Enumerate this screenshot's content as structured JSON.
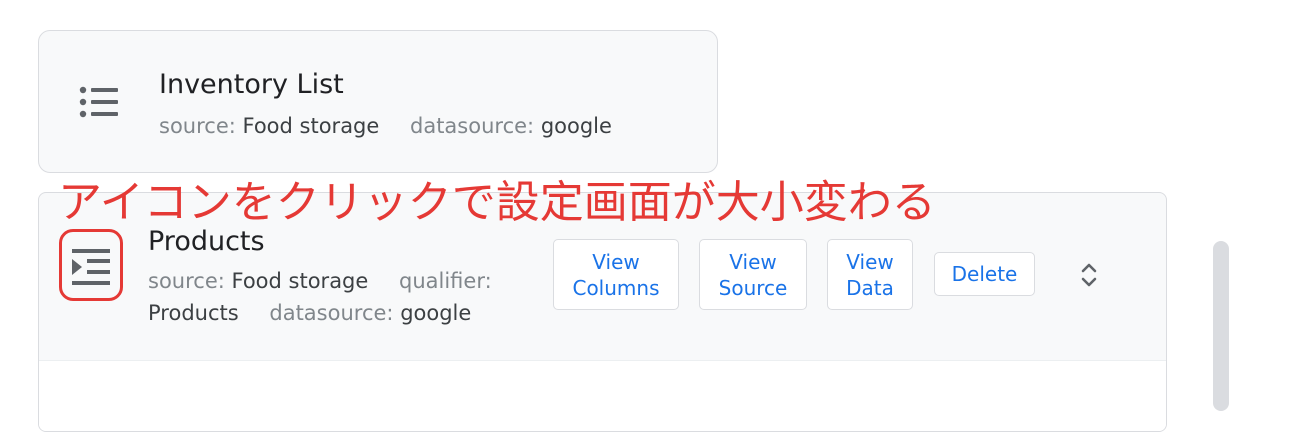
{
  "inventory_card": {
    "icon": "list-icon",
    "title": "Inventory List",
    "source_key": "source:",
    "source_value": "Food storage",
    "datasource_key": "datasource:",
    "datasource_value": "google"
  },
  "annotation": {
    "text": "アイコンをクリックで設定画面が大小変わる",
    "color": "#e53935"
  },
  "products_card": {
    "icon": "format-indent-increase-icon",
    "title": "Products",
    "source_key": "source:",
    "source_value": "Food storage",
    "qualifier_key": "qualifier:",
    "qualifier_value": "Products",
    "datasource_key": "datasource:",
    "datasource_value": "google",
    "buttons": {
      "view_columns": [
        "View",
        "Columns"
      ],
      "view_source": [
        "View",
        "Source"
      ],
      "view_data": [
        "View",
        "Data"
      ],
      "delete": "Delete"
    },
    "expand_icon": "unfold-more-icon"
  },
  "colors": {
    "accent": "#1a73e8",
    "highlight": "#e53935",
    "card_bg": "#f8f9fa"
  }
}
